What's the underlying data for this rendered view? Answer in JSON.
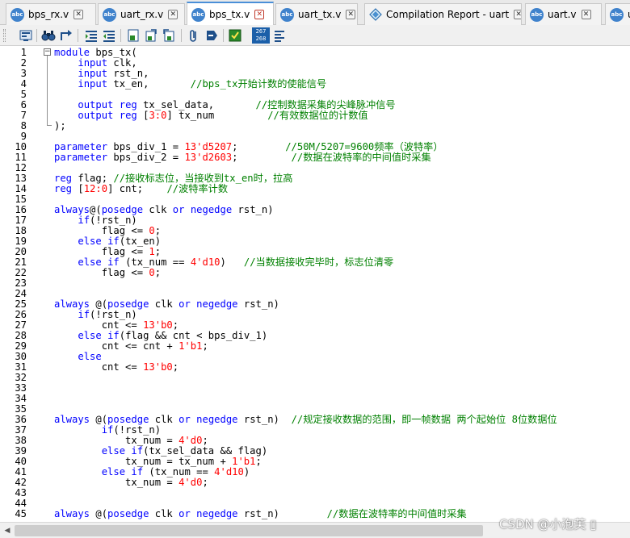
{
  "tabs": [
    {
      "label": "bps_rx.v",
      "icon": "verilog-file-icon",
      "active": false
    },
    {
      "label": "uart_rx.v",
      "icon": "verilog-file-icon",
      "active": false
    },
    {
      "label": "bps_tx.v",
      "icon": "verilog-file-icon",
      "active": true
    },
    {
      "label": "uart_tx.v",
      "icon": "verilog-file-icon",
      "active": false
    },
    {
      "label": "Compilation Report - uart",
      "icon": "report-icon",
      "active": false
    },
    {
      "label": "uart.v",
      "icon": "verilog-file-icon",
      "active": false
    },
    {
      "label": "u",
      "icon": "verilog-file-icon",
      "active": false
    }
  ],
  "tab_icon_text": "abc",
  "tab_close_glyph": "✕",
  "toolbar": {
    "buttons": [
      "open-file-icon",
      "find-icon",
      "find-next-icon",
      "increase-indent-icon",
      "decrease-indent-icon",
      "insert-template-icon",
      "bookmark-icon",
      "previous-bookmark-icon",
      "attach-icon",
      "comment-icon",
      "uncomment-icon",
      "line-number-icon",
      "toggle-whitespace-icon"
    ],
    "line_number_button_text": "267\n268"
  },
  "editor": {
    "line_numbers": [
      "1",
      "2",
      "3",
      "4",
      "5",
      "6",
      "7",
      "8",
      "9",
      "10",
      "11",
      "12",
      "13",
      "14",
      "15",
      "16",
      "17",
      "18",
      "19",
      "20",
      "21",
      "22",
      "23",
      "24",
      "25",
      "26",
      "27",
      "28",
      "29",
      "30",
      "31",
      "32",
      "33",
      "34",
      "35",
      "36",
      "37",
      "38",
      "39",
      "40",
      "41",
      "42",
      "43",
      "44",
      "45"
    ],
    "lines": [
      [
        [
          "k",
          "module"
        ],
        [
          "p",
          " bps_tx("
        ]
      ],
      [
        [
          "p",
          "    "
        ],
        [
          "k",
          "input"
        ],
        [
          "p",
          " clk,"
        ]
      ],
      [
        [
          "p",
          "    "
        ],
        [
          "k",
          "input"
        ],
        [
          "p",
          " rst_n,"
        ]
      ],
      [
        [
          "p",
          "    "
        ],
        [
          "k",
          "input"
        ],
        [
          "p",
          " tx_en,       "
        ],
        [
          "c",
          "//bps_tx开始计数的使能信号"
        ]
      ],
      [],
      [
        [
          "p",
          "    "
        ],
        [
          "k",
          "output"
        ],
        [
          "p",
          " "
        ],
        [
          "k",
          "reg"
        ],
        [
          "p",
          " tx_sel_data,       "
        ],
        [
          "c",
          "//控制数据采集的尖峰脉冲信号"
        ]
      ],
      [
        [
          "p",
          "    "
        ],
        [
          "k",
          "output"
        ],
        [
          "p",
          " "
        ],
        [
          "k",
          "reg"
        ],
        [
          "p",
          " ["
        ],
        [
          "n",
          "3:0"
        ],
        [
          "p",
          "] tx_num         "
        ],
        [
          "c",
          "//有效数据位的计数值"
        ]
      ],
      [
        [
          "p",
          ");"
        ]
      ],
      [],
      [
        [
          "k",
          "parameter"
        ],
        [
          "p",
          " bps_div_1 = "
        ],
        [
          "n",
          "13'd5207"
        ],
        [
          "p",
          ";        "
        ],
        [
          "c",
          "//50M/5207=9600频率（波特率）"
        ]
      ],
      [
        [
          "k",
          "parameter"
        ],
        [
          "p",
          " bps_div_2 = "
        ],
        [
          "n",
          "13'd2603"
        ],
        [
          "p",
          ";         "
        ],
        [
          "c",
          "//数据在波特率的中间值时采集"
        ]
      ],
      [],
      [
        [
          "k",
          "reg"
        ],
        [
          "p",
          " flag; "
        ],
        [
          "c",
          "//接收标志位，当接收到tx_en时，拉高"
        ]
      ],
      [
        [
          "k",
          "reg"
        ],
        [
          "p",
          " ["
        ],
        [
          "n",
          "12:0"
        ],
        [
          "p",
          "] cnt;    "
        ],
        [
          "c",
          "//波特率计数"
        ]
      ],
      [],
      [
        [
          "k",
          "always"
        ],
        [
          "p",
          "@("
        ],
        [
          "k",
          "posedge"
        ],
        [
          "p",
          " clk "
        ],
        [
          "k",
          "or"
        ],
        [
          "p",
          " "
        ],
        [
          "k",
          "negedge"
        ],
        [
          "p",
          " rst_n)"
        ]
      ],
      [
        [
          "p",
          "    "
        ],
        [
          "k",
          "if"
        ],
        [
          "p",
          "(!rst_n)"
        ]
      ],
      [
        [
          "p",
          "        flag <= "
        ],
        [
          "n",
          "0"
        ],
        [
          "p",
          ";"
        ]
      ],
      [
        [
          "p",
          "    "
        ],
        [
          "k",
          "else"
        ],
        [
          "p",
          " "
        ],
        [
          "k",
          "if"
        ],
        [
          "p",
          "(tx_en)"
        ]
      ],
      [
        [
          "p",
          "        flag <= "
        ],
        [
          "n",
          "1"
        ],
        [
          "p",
          ";"
        ]
      ],
      [
        [
          "p",
          "    "
        ],
        [
          "k",
          "else"
        ],
        [
          "p",
          " "
        ],
        [
          "k",
          "if"
        ],
        [
          "p",
          " (tx_num == "
        ],
        [
          "n",
          "4'd10"
        ],
        [
          "p",
          ")   "
        ],
        [
          "c",
          "//当数据接收完毕时，标志位清零"
        ]
      ],
      [
        [
          "p",
          "        flag <= "
        ],
        [
          "n",
          "0"
        ],
        [
          "p",
          ";"
        ]
      ],
      [],
      [],
      [
        [
          "k",
          "always"
        ],
        [
          "p",
          " @("
        ],
        [
          "k",
          "posedge"
        ],
        [
          "p",
          " clk "
        ],
        [
          "k",
          "or"
        ],
        [
          "p",
          " "
        ],
        [
          "k",
          "negedge"
        ],
        [
          "p",
          " rst_n)"
        ]
      ],
      [
        [
          "p",
          "    "
        ],
        [
          "k",
          "if"
        ],
        [
          "p",
          "(!rst_n)"
        ]
      ],
      [
        [
          "p",
          "        cnt <= "
        ],
        [
          "n",
          "13'b0"
        ],
        [
          "p",
          ";"
        ]
      ],
      [
        [
          "p",
          "    "
        ],
        [
          "k",
          "else"
        ],
        [
          "p",
          " "
        ],
        [
          "k",
          "if"
        ],
        [
          "p",
          "(flag && cnt < bps_div_1)"
        ]
      ],
      [
        [
          "p",
          "        cnt <= cnt + "
        ],
        [
          "n",
          "1'b1"
        ],
        [
          "p",
          ";"
        ]
      ],
      [
        [
          "p",
          "    "
        ],
        [
          "k",
          "else"
        ]
      ],
      [
        [
          "p",
          "        cnt <= "
        ],
        [
          "n",
          "13'b0"
        ],
        [
          "p",
          ";"
        ]
      ],
      [],
      [],
      [],
      [],
      [
        [
          "k",
          "always"
        ],
        [
          "p",
          " @("
        ],
        [
          "k",
          "posedge"
        ],
        [
          "p",
          " clk "
        ],
        [
          "k",
          "or"
        ],
        [
          "p",
          " "
        ],
        [
          "k",
          "negedge"
        ],
        [
          "p",
          " rst_n)  "
        ],
        [
          "c",
          "//规定接收数据的范围，即一帧数据 两个起始位 8位数据位"
        ]
      ],
      [
        [
          "p",
          "        "
        ],
        [
          "k",
          "if"
        ],
        [
          "p",
          "(!rst_n)"
        ]
      ],
      [
        [
          "p",
          "            tx_num = "
        ],
        [
          "n",
          "4'd0"
        ],
        [
          "p",
          ";"
        ]
      ],
      [
        [
          "p",
          "        "
        ],
        [
          "k",
          "else"
        ],
        [
          "p",
          " "
        ],
        [
          "k",
          "if"
        ],
        [
          "p",
          "(tx_sel_data && flag)"
        ]
      ],
      [
        [
          "p",
          "            tx_num = tx_num + "
        ],
        [
          "n",
          "1'b1"
        ],
        [
          "p",
          ";"
        ]
      ],
      [
        [
          "p",
          "        "
        ],
        [
          "k",
          "else"
        ],
        [
          "p",
          " "
        ],
        [
          "k",
          "if"
        ],
        [
          "p",
          " (tx_num == "
        ],
        [
          "n",
          "4'd10"
        ],
        [
          "p",
          ")"
        ]
      ],
      [
        [
          "p",
          "            tx_num = "
        ],
        [
          "n",
          "4'd0"
        ],
        [
          "p",
          ";"
        ]
      ],
      [],
      [],
      [
        [
          "k",
          "always"
        ],
        [
          "p",
          " @("
        ],
        [
          "k",
          "posedge"
        ],
        [
          "p",
          " clk "
        ],
        [
          "k",
          "or"
        ],
        [
          "p",
          " "
        ],
        [
          "k",
          "negedge"
        ],
        [
          "p",
          " rst_n)        "
        ],
        [
          "c",
          "//数据在波特率的中间值时采集"
        ]
      ]
    ]
  },
  "colors": {
    "keyword": "#0000ff",
    "number": "#ff0000",
    "comment": "#008000",
    "active_tab_accent": "#4a8fd8"
  },
  "watermark": "CSDN @小泡芙 ▯"
}
